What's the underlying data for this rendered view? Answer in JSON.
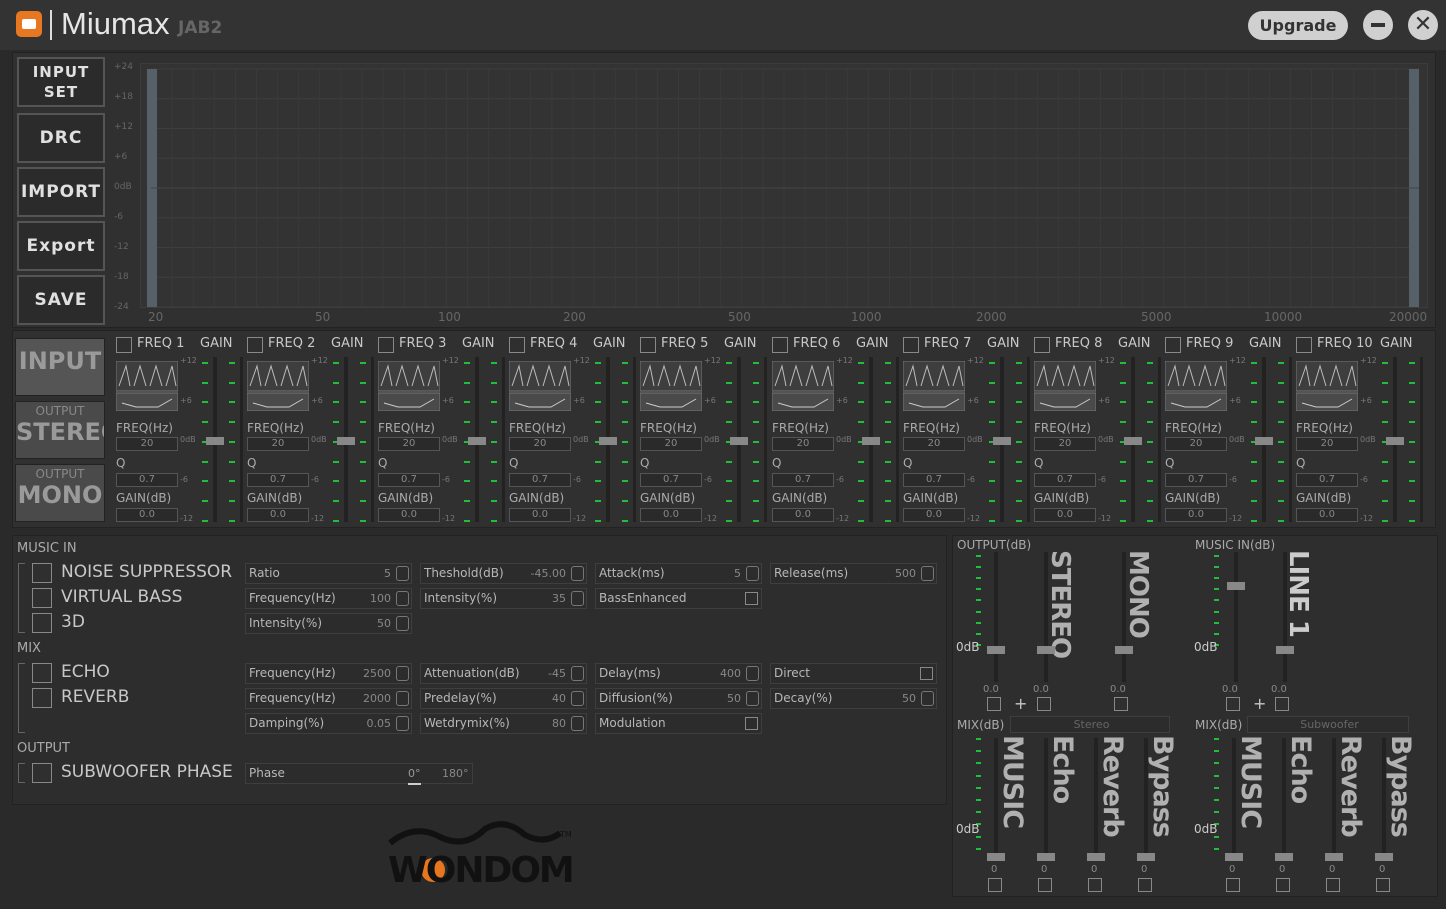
{
  "app": {
    "title": "Miumax",
    "subtitle": "JAB2",
    "upgrade": "Upgrade",
    "close": "✕"
  },
  "sidebar": {
    "buttons": [
      "INPUT\nSET",
      "DRC",
      "IMPORT",
      "Export",
      "SAVE"
    ]
  },
  "graph": {
    "ylabels": [
      "+24",
      "+18",
      "+12",
      "+6",
      "0dB",
      "-6",
      "-12",
      "-18",
      "-24"
    ],
    "xlabels": [
      "20",
      "50",
      "100",
      "200",
      "500",
      "1000",
      "2000",
      "5000",
      "10000",
      "20000"
    ]
  },
  "modes": [
    {
      "small": "",
      "big": "INPUT"
    },
    {
      "small": "OUTPUT",
      "big": "STEREO"
    },
    {
      "small": "OUTPUT",
      "big": "MONO"
    }
  ],
  "bands": [
    {
      "name": "FREQ 1",
      "gain": "GAIN",
      "freq_label": "FREQ(Hz)",
      "freq": "20",
      "q_label": "Q",
      "q": "0.7",
      "gain_label": "GAIN(dB)",
      "gain_val": "0.0"
    },
    {
      "name": "FREQ 2",
      "gain": "GAIN",
      "freq_label": "FREQ(Hz)",
      "freq": "20",
      "q_label": "Q",
      "q": "0.7",
      "gain_label": "GAIN(dB)",
      "gain_val": "0.0"
    },
    {
      "name": "FREQ 3",
      "gain": "GAIN",
      "freq_label": "FREQ(Hz)",
      "freq": "20",
      "q_label": "Q",
      "q": "0.7",
      "gain_label": "GAIN(dB)",
      "gain_val": "0.0"
    },
    {
      "name": "FREQ 4",
      "gain": "GAIN",
      "freq_label": "FREQ(Hz)",
      "freq": "20",
      "q_label": "Q",
      "q": "0.7",
      "gain_label": "GAIN(dB)",
      "gain_val": "0.0"
    },
    {
      "name": "FREQ 5",
      "gain": "GAIN",
      "freq_label": "FREQ(Hz)",
      "freq": "20",
      "q_label": "Q",
      "q": "0.7",
      "gain_label": "GAIN(dB)",
      "gain_val": "0.0"
    },
    {
      "name": "FREQ 6",
      "gain": "GAIN",
      "freq_label": "FREQ(Hz)",
      "freq": "20",
      "q_label": "Q",
      "q": "0.7",
      "gain_label": "GAIN(dB)",
      "gain_val": "0.0"
    },
    {
      "name": "FREQ 7",
      "gain": "GAIN",
      "freq_label": "FREQ(Hz)",
      "freq": "20",
      "q_label": "Q",
      "q": "0.7",
      "gain_label": "GAIN(dB)",
      "gain_val": "0.0"
    },
    {
      "name": "FREQ 8",
      "gain": "GAIN",
      "freq_label": "FREQ(Hz)",
      "freq": "20",
      "q_label": "Q",
      "q": "0.7",
      "gain_label": "GAIN(dB)",
      "gain_val": "0.0"
    },
    {
      "name": "FREQ 9",
      "gain": "GAIN",
      "freq_label": "FREQ(Hz)",
      "freq": "20",
      "q_label": "Q",
      "q": "0.7",
      "gain_label": "GAIN(dB)",
      "gain_val": "0.0"
    },
    {
      "name": "FREQ 10",
      "gain": "GAIN",
      "freq_label": "FREQ(Hz)",
      "freq": "20",
      "q_label": "Q",
      "q": "0.7",
      "gain_label": "GAIN(dB)",
      "gain_val": "0.0"
    }
  ],
  "band_scale": [
    "+12",
    "+6",
    "0dB",
    "-6",
    "-12"
  ],
  "music_in": {
    "title": "MUSIC IN",
    "options": [
      "NOISE SUPPRESSOR",
      "VIRTUAL BASS",
      "3D"
    ]
  },
  "mix": {
    "title": "MIX",
    "options": [
      "ECHO",
      "REVERB"
    ]
  },
  "output": {
    "title": "OUTPUT",
    "options": [
      "SUBWOOFER PHASE"
    ]
  },
  "fields": {
    "ns": [
      {
        "l": "Ratio",
        "v": "5"
      },
      {
        "l": "Theshold(dB)",
        "v": "-45.00"
      },
      {
        "l": "Attack(ms)",
        "v": "5"
      },
      {
        "l": "Release(ms)",
        "v": "500"
      }
    ],
    "vb": [
      {
        "l": "Frequency(Hz)",
        "v": "100"
      },
      {
        "l": "Intensity(%)",
        "v": "35"
      },
      {
        "l": "BassEnhanced",
        "v": ""
      }
    ],
    "d3": [
      {
        "l": "Intensity(%)",
        "v": "50"
      }
    ],
    "echo": [
      {
        "l": "Frequency(Hz)",
        "v": "2500"
      },
      {
        "l": "Attenuation(dB)",
        "v": "-45"
      },
      {
        "l": "Delay(ms)",
        "v": "400"
      },
      {
        "l": "Direct",
        "v": ""
      }
    ],
    "rev1": [
      {
        "l": "Frequency(Hz)",
        "v": "2000"
      },
      {
        "l": "Predelay(%)",
        "v": "40"
      },
      {
        "l": "Diffusion(%)",
        "v": "50"
      },
      {
        "l": "Decay(%)",
        "v": "50"
      }
    ],
    "rev2": [
      {
        "l": "Damping(%)",
        "v": "0.05"
      },
      {
        "l": "Wetdrymix(%)",
        "v": "80"
      },
      {
        "l": "Modulation",
        "v": ""
      }
    ],
    "phase": {
      "l": "Phase",
      "a": "0°",
      "b": "180°"
    }
  },
  "right": {
    "output_db": "OUTPUT(dB)",
    "music_in_db": "MUSIC IN(dB)",
    "mix_db": "MIX(dB)",
    "stereo": "STEREO",
    "mono": "MONO",
    "line1": "LINE 1",
    "zero_db": "0dB",
    "val": "0.0",
    "plus": "+",
    "stereo_btn": "Stereo",
    "sub_btn": "Subwoofer",
    "mix_cols": [
      "MUSIC",
      "Echo",
      "Reverb",
      "Bypass"
    ],
    "mix_val": "0"
  },
  "brand": "WONDOM"
}
